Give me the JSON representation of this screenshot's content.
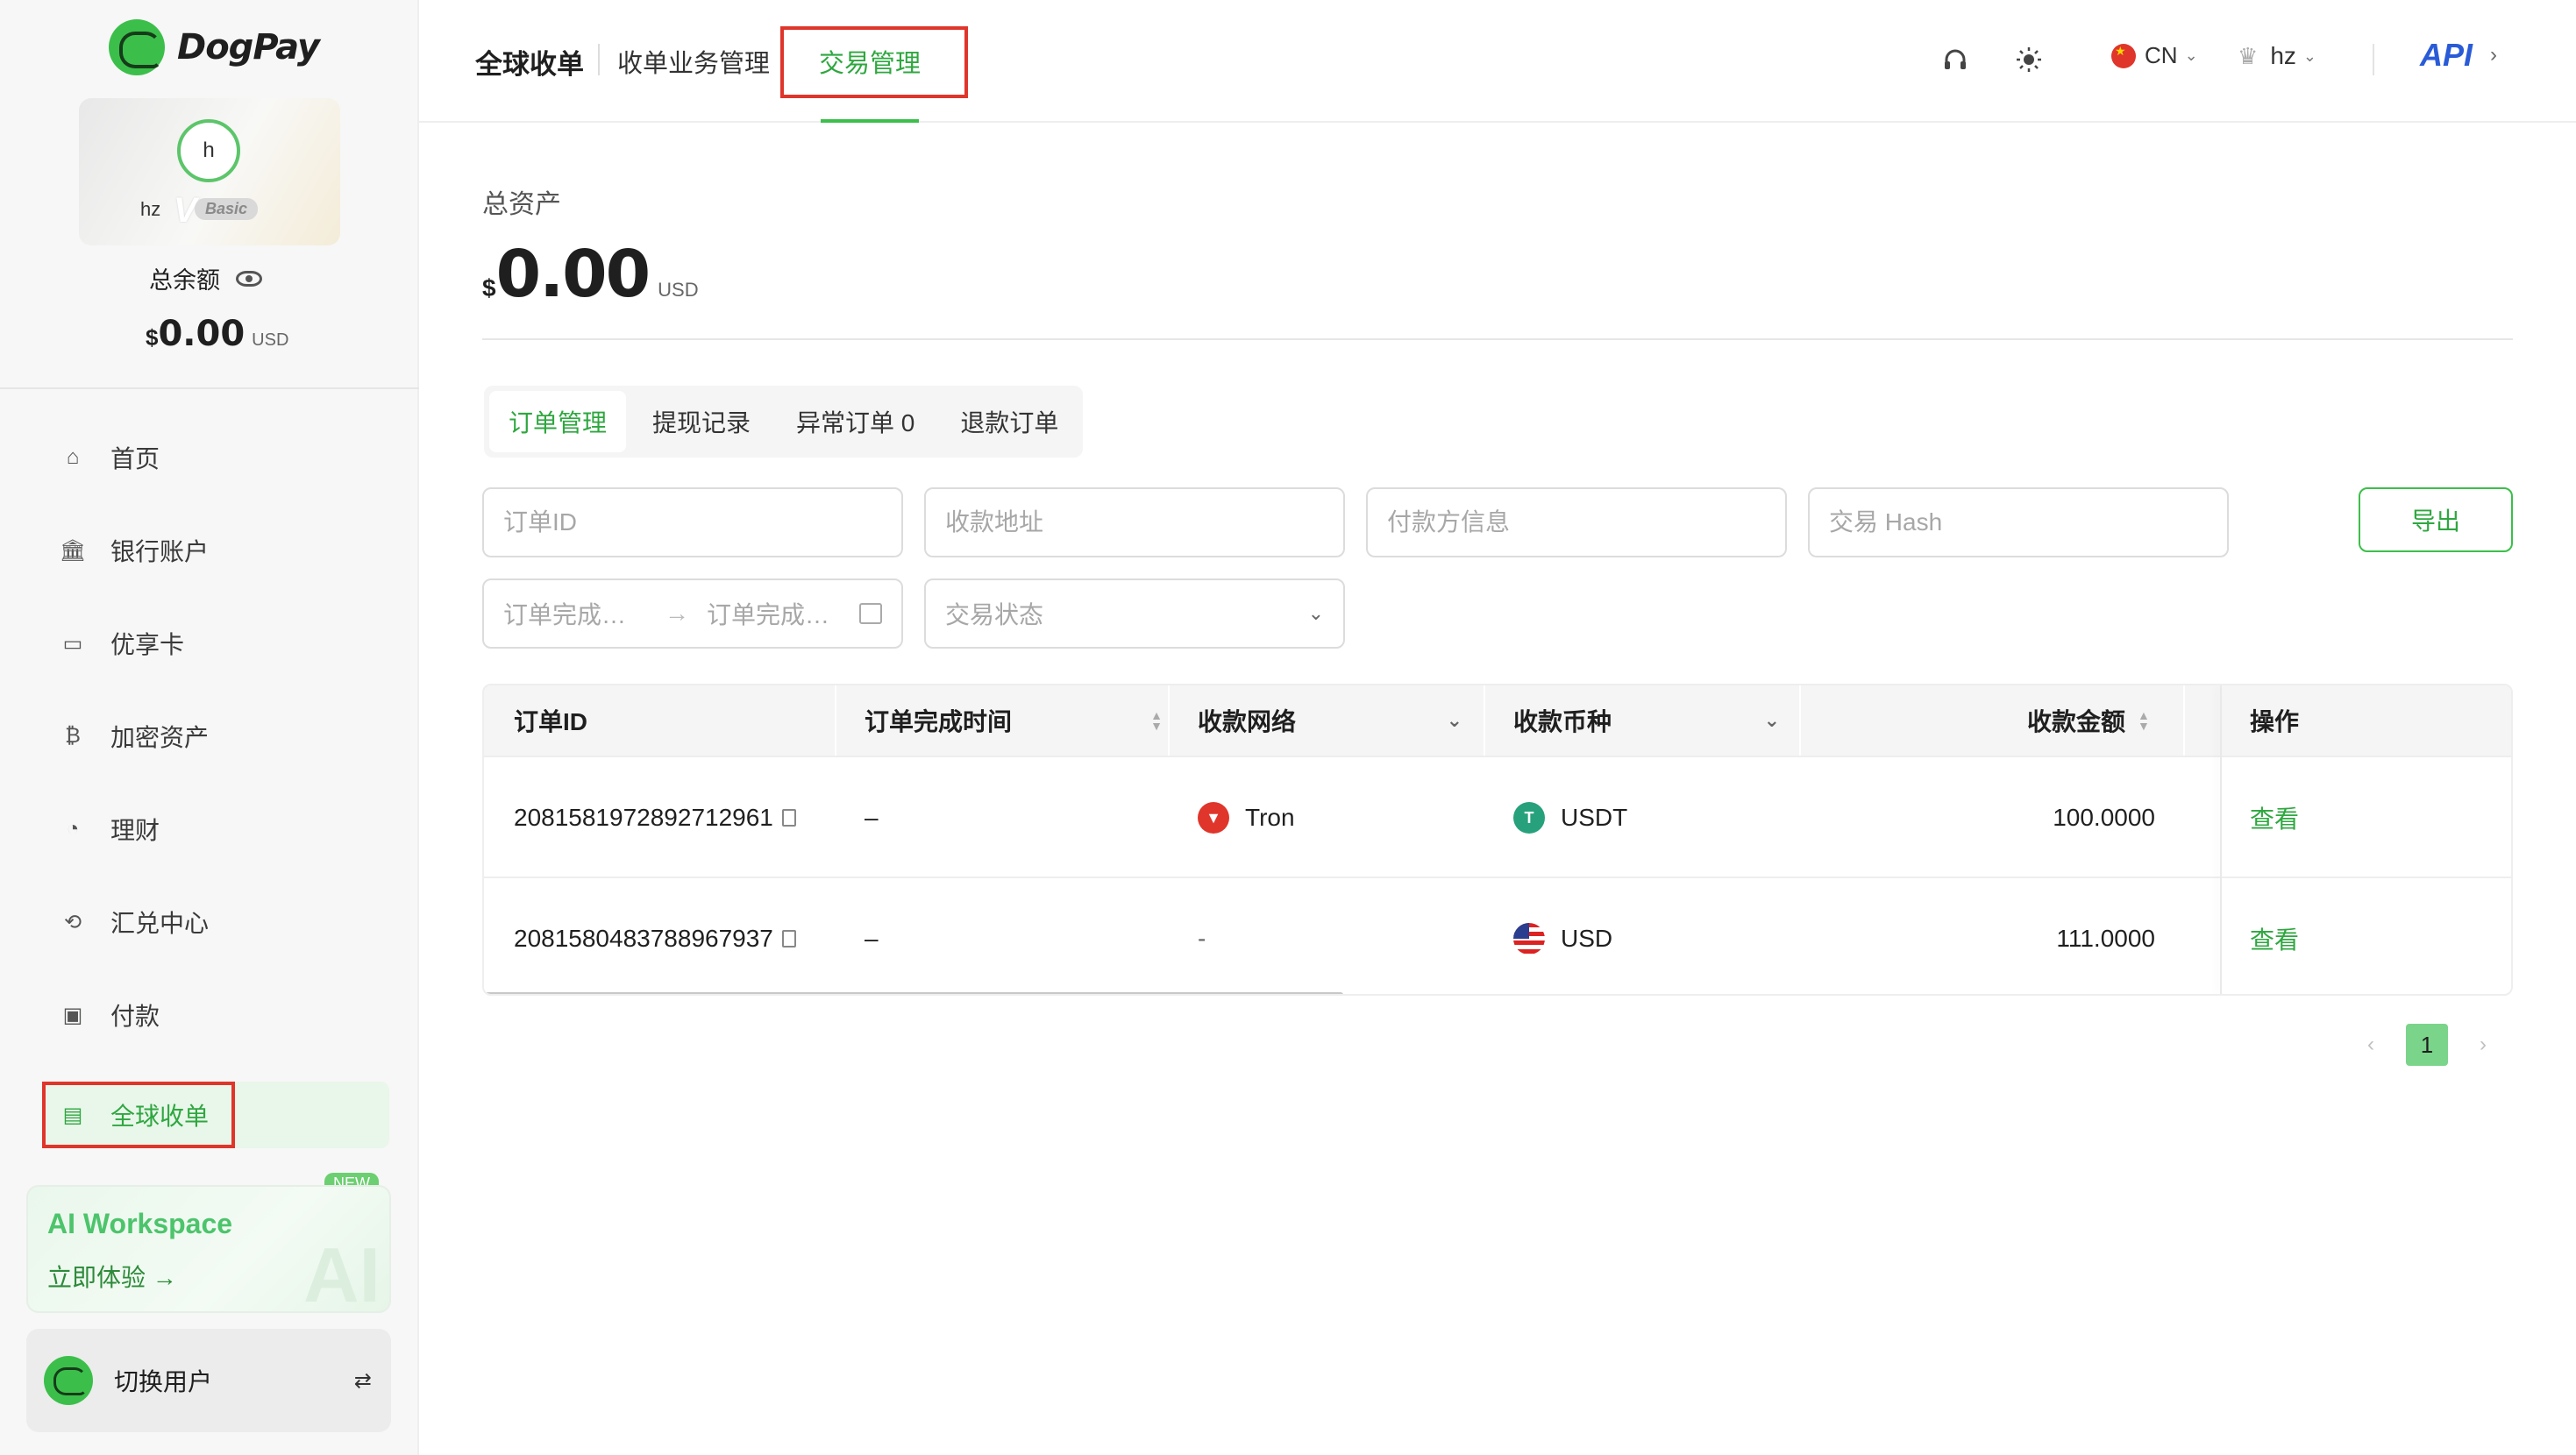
{
  "brand": {
    "name": "DogPay"
  },
  "user_card": {
    "avatar_initial": "h",
    "username": "hz",
    "tier_letter": "V",
    "tier": "Basic"
  },
  "balance": {
    "label": "总余额",
    "symbol": "$",
    "amount": "0.00",
    "unit": "USD"
  },
  "sidebar": {
    "items": [
      {
        "label": "首页",
        "icon": "home-icon",
        "glyph": "⌂",
        "active": false
      },
      {
        "label": "银行账户",
        "icon": "bank-icon",
        "glyph": "🏛",
        "active": false
      },
      {
        "label": "优享卡",
        "icon": "card-icon",
        "glyph": "▭",
        "active": false
      },
      {
        "label": "加密资产",
        "icon": "bitcoin-icon",
        "glyph": "₿",
        "active": false
      },
      {
        "label": "理财",
        "icon": "finance-chart-icon",
        "glyph": "◔",
        "active": false
      },
      {
        "label": "汇兑中心",
        "icon": "exchange-icon",
        "glyph": "⟲",
        "active": false
      },
      {
        "label": "付款",
        "icon": "wallet-icon",
        "glyph": "▣",
        "active": false
      },
      {
        "label": "全球收单",
        "icon": "global-acquiring-icon",
        "glyph": "▤",
        "active": true
      }
    ]
  },
  "ai_workspace": {
    "badge": "NEW",
    "title": "AI Workspace",
    "cta": "立即体验 →",
    "bg_letters": "AI"
  },
  "switch_user": {
    "label": "切换用户",
    "icon_glyph": "⇄"
  },
  "header": {
    "section_title": "全球收单",
    "tabs": [
      {
        "label": "收单业务管理",
        "active": false
      },
      {
        "label": "交易管理",
        "active": true
      }
    ],
    "icons": {
      "support": "headset-icon",
      "theme": "sun-icon"
    },
    "language": "CN",
    "username": "hz",
    "api_label": "API",
    "api_chevron": "›"
  },
  "assets": {
    "label": "总资产",
    "symbol": "$",
    "amount": "0.00",
    "unit": "USD"
  },
  "sub_tabs": [
    {
      "label": "订单管理",
      "active": true
    },
    {
      "label": "提现记录",
      "active": false
    },
    {
      "label": "异常订单 0",
      "active": false
    },
    {
      "label": "退款订单",
      "active": false
    }
  ],
  "filters": {
    "order_id_placeholder": "订单ID",
    "address_placeholder": "收款地址",
    "payer_placeholder": "付款方信息",
    "hash_placeholder": "交易 Hash",
    "date_start_placeholder": "订单完成…",
    "date_end_placeholder": "订单完成…",
    "date_arrow": "→",
    "status_placeholder": "交易状态",
    "export_label": "导出"
  },
  "table": {
    "columns": [
      "订单ID",
      "订单完成时间",
      "收款网络",
      "收款币种",
      "收款金额",
      "操作"
    ],
    "rows": [
      {
        "order_id": "2081581972892712961",
        "completed_at": "–",
        "network": "Tron",
        "network_icon": "tron-icon",
        "currency": "USDT",
        "currency_icon": "usdt-icon",
        "amount": "100.0000",
        "action": "查看"
      },
      {
        "order_id": "2081580483788967937",
        "completed_at": "–",
        "network": "-",
        "network_icon": "",
        "currency": "USD",
        "currency_icon": "us-flag-icon",
        "amount": "111.0000",
        "action": "查看"
      }
    ]
  },
  "pagination": {
    "prev": "‹",
    "current": "1",
    "next": "›"
  },
  "colors": {
    "accent": "#3bbf4a",
    "accent_text": "#2ea73f",
    "annotation_red": "#e0352b",
    "api_blue": "#2a5bd7"
  }
}
